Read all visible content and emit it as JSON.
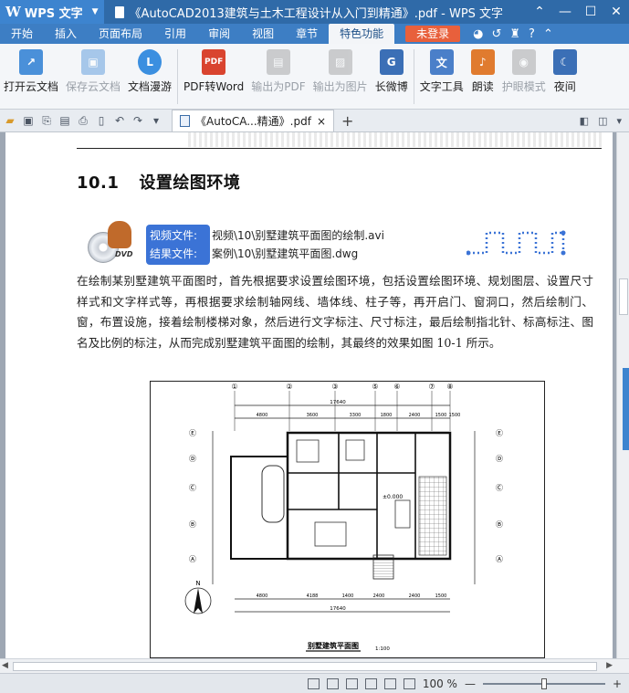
{
  "app": {
    "name": "WPS 文字",
    "title": "《AutoCAD2013建筑与土木工程设计从入门到精通》.pdf - WPS 文字"
  },
  "window_controls": [
    "⌃",
    "—",
    "☐",
    "✕"
  ],
  "menu": {
    "tabs": [
      "开始",
      "插入",
      "页面布局",
      "引用",
      "审阅",
      "视图",
      "章节",
      "特色功能"
    ],
    "active": "特色功能",
    "login_label": "未登录"
  },
  "ribbon": {
    "buttons": [
      {
        "label": "打开云文档",
        "enabled": true,
        "color": "#4a90d9"
      },
      {
        "label": "保存云文档",
        "enabled": false,
        "color": "#4a90d9"
      },
      {
        "label": "文档漫游",
        "enabled": true,
        "color": "#3b8fe0"
      },
      {
        "label": "PDF转Word",
        "enabled": true,
        "color": "#d9442f"
      },
      {
        "label": "输出为PDF",
        "enabled": false,
        "color": "#999999"
      },
      {
        "label": "输出为图片",
        "enabled": false,
        "color": "#999999"
      },
      {
        "label": "长微博",
        "enabled": true,
        "color": "#3b6fb6"
      },
      {
        "label": "文字工具",
        "enabled": true,
        "color": "#4a7fc9"
      },
      {
        "label": "朗读",
        "enabled": true,
        "color": "#e07b2f"
      },
      {
        "label": "护眼模式",
        "enabled": false,
        "color": "#999999"
      },
      {
        "label": "夜间",
        "enabled": true,
        "color": "#3b6fb6"
      }
    ]
  },
  "doc_tab": {
    "label": "《AutoCA...精通》.pdf",
    "close": "×"
  },
  "document": {
    "section_number": "10.1",
    "section_title": "设置绘图环境",
    "dvd_label": "DVD",
    "video_label": "视频文件:",
    "video_value": "视频\\10\\别墅建筑平面图的绘制.avi",
    "result_label": "结果文件:",
    "result_value": "案例\\10\\别墅建筑平面图.dwg",
    "paragraph": "在绘制某别墅建筑平面图时，首先根据要求设置绘图环境，包括设置绘图环境、规划图层、设置尺寸样式和文字样式等，再根据要求绘制轴网线、墙体线、柱子等，再开启门、窗洞口，然后绘制门、窗，布置设施，接着绘制楼梯对象，然后进行文字标注、尺寸标注，最后绘制指北针、标高标注、图名及比例的标注，从而完成别墅建筑平面图的绘制，其最终的效果如图 10-1 所示。",
    "figure": {
      "axis_top": [
        "①",
        "②",
        "③",
        "⑤",
        "⑥",
        "⑦",
        "⑧"
      ],
      "dims_top": [
        "4800",
        "3600",
        "3300",
        "1800",
        "2400",
        "1500",
        "1500"
      ],
      "total": "17640",
      "dims_bottom": [
        "4800",
        "4188",
        "1400",
        "2400",
        "2400",
        "1500"
      ],
      "axis_left": [
        "Ⓔ",
        "Ⓓ",
        "Ⓒ",
        "Ⓑ",
        "Ⓐ"
      ],
      "elevation": "±0.000",
      "north": "N",
      "caption": "别墅建筑平面图",
      "scale": "1:100"
    }
  },
  "statusbar": {
    "zoom": "100 %",
    "zoom_fraction": 0.5
  }
}
